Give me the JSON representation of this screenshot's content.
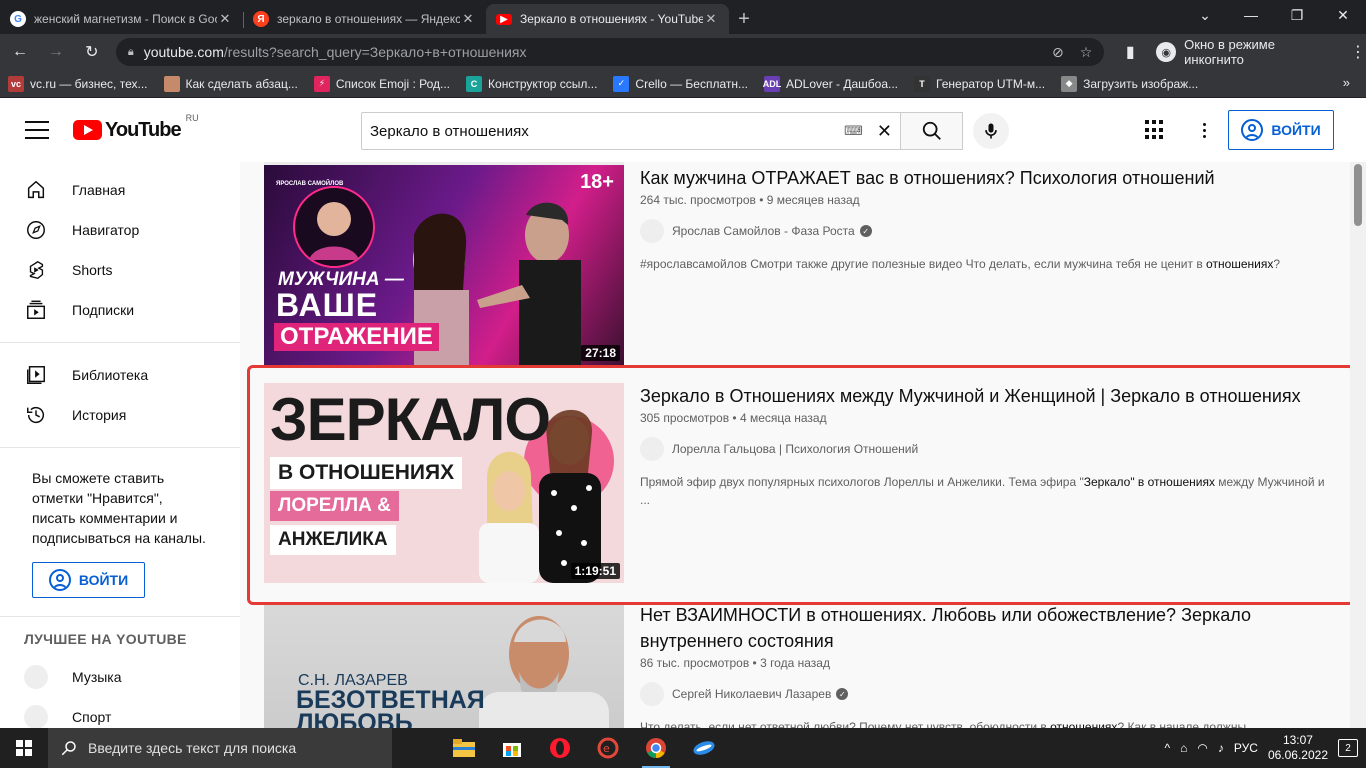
{
  "browser": {
    "tabs": [
      {
        "title": "женский магнетизм - Поиск в Google",
        "favicon": "google-icon",
        "color": "#ffffff"
      },
      {
        "title": "зеркало в отношениях — Яндекс",
        "favicon": "yandex-icon",
        "color": "#fc3f1d"
      },
      {
        "title": "Зеркало в отношениях - YouTube",
        "favicon": "youtube-icon",
        "color": "#ff0000",
        "active": true
      }
    ],
    "url_host": "youtube.com",
    "url_path": "/results?search_query=Зеркало+в+отношениях",
    "incognito_label": "Окно в режиме инкогнито",
    "bookmarks": [
      {
        "label": "vc.ru — бизнес, тех...",
        "color": "#b23b3b",
        "glyph": "vc"
      },
      {
        "label": "Как сделать абзац...",
        "color": "#c58a6a",
        "glyph": ""
      },
      {
        "label": "Список Emoji : Род...",
        "color": "#e0245e",
        "glyph": "⚡"
      },
      {
        "label": "Конструктор ссыл...",
        "color": "#1aa39a",
        "glyph": "C"
      },
      {
        "label": "Crello — Бесплатн...",
        "color": "#2979ff",
        "glyph": "✓"
      },
      {
        "label": "ADLover - Дашбоа...",
        "color": "#6a3fb5",
        "glyph": "ADL"
      },
      {
        "label": "Генератор UTM-м...",
        "color": "#333333",
        "glyph": "T"
      },
      {
        "label": "Загрузить изображ...",
        "color": "#888888",
        "glyph": "◆"
      }
    ]
  },
  "youtube": {
    "logo_text": "YouTube",
    "country_code": "RU",
    "search_value": "Зеркало в отношениях",
    "signin_label": "ВОЙТИ",
    "sidebar": {
      "main": [
        {
          "label": "Главная",
          "icon": "home-icon"
        },
        {
          "label": "Навигатор",
          "icon": "compass-icon"
        },
        {
          "label": "Shorts",
          "icon": "shorts-icon"
        },
        {
          "label": "Подписки",
          "icon": "subscriptions-icon"
        }
      ],
      "library": [
        {
          "label": "Библиотека",
          "icon": "library-icon"
        },
        {
          "label": "История",
          "icon": "history-icon"
        }
      ],
      "signin_hint": "Вы сможете ставить отметки \"Нравится\", писать комментарии и подписываться на каналы.",
      "signin_label": "ВОЙТИ",
      "best_title": "ЛУЧШЕЕ НА YOUTUBE",
      "best": [
        {
          "label": "Музыка"
        },
        {
          "label": "Спорт"
        }
      ]
    },
    "results": [
      {
        "title": "Как мужчина ОТРАЖАЕТ вас в отношениях? Психология отношений",
        "stats": "264 тыс. просмотров • 9 месяцев назад",
        "channel": "Ярослав Самойлов - Фаза Роста",
        "verified": true,
        "desc_pre": "#ярославсамойлов Смотри также другие полезные видео Что делать, если мужчина тебя не ценит в ",
        "desc_bold": "отношениях",
        "desc_post": "?",
        "duration": "27:18",
        "thumb_lines": [
          "МУЖЧИНА —",
          "ВАШЕ",
          "ОТРАЖЕНИЕ"
        ],
        "thumb_badge": "18+",
        "thumb_brand": "ЯРОСЛАВ САМОЙЛОВ"
      },
      {
        "title": "Зеркало в Отношениях между Мужчиной и Женщиной | Зеркало в отношениях",
        "stats": "305 просмотров • 4 месяца назад",
        "channel": "Лорелла Гальцова | Психология Отношений",
        "verified": false,
        "desc_pre": "Прямой эфир двух популярных психологов Лореллы и Анжелики. Тема эфира \"",
        "desc_bold": "Зеркало\" в отношениях",
        "desc_post": " между Мужчиной и ...",
        "duration": "1:19:51",
        "thumb_lines": [
          "ЗЕРКАЛО",
          "В ОТНОШЕНИЯХ",
          "ЛОРЕЛЛА &",
          "АНЖЕЛИКА"
        ]
      },
      {
        "title": "Нет ВЗАИМНОСТИ в отношениях. Любовь или обожествление? Зеркало внутреннего состояния",
        "stats": "86 тыс. просмотров • 3 года назад",
        "channel": "Сергей Николаевич Лазарев",
        "verified": true,
        "desc_pre": "Что делать, если нет ответной любви? Почему нет чувств, обоюдности в ",
        "desc_bold": "отношениях",
        "desc_post": "? Как в начале должны",
        "thumb_lines": [
          "С.Н. ЛАЗАРЕВ",
          "БЕЗОТВЕТНАЯ",
          "ЛЮБОВЬ"
        ]
      }
    ]
  },
  "taskbar": {
    "search_placeholder": "Введите здесь текст для поиска",
    "lang": "РУС",
    "time": "13:07",
    "date": "06.06.2022",
    "notifications": "2"
  }
}
